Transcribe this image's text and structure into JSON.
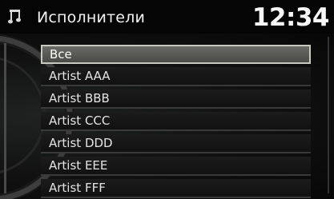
{
  "header": {
    "icon": "music-note-icon",
    "title": "Исполнители",
    "clock": "12:34"
  },
  "list": {
    "items": [
      {
        "label": "Все",
        "selected": true
      },
      {
        "label": "Artist AAA",
        "selected": false
      },
      {
        "label": "Artist BBB",
        "selected": false
      },
      {
        "label": "Artist CCC",
        "selected": false
      },
      {
        "label": "Artist DDD",
        "selected": false
      },
      {
        "label": "Artist EEE",
        "selected": false
      },
      {
        "label": "Artist FFF",
        "selected": false
      }
    ]
  },
  "colors": {
    "background": "#000000",
    "text": "#f2f2f2",
    "selected_fill": "#5a5a56",
    "selected_border": "#c9c9c2"
  }
}
